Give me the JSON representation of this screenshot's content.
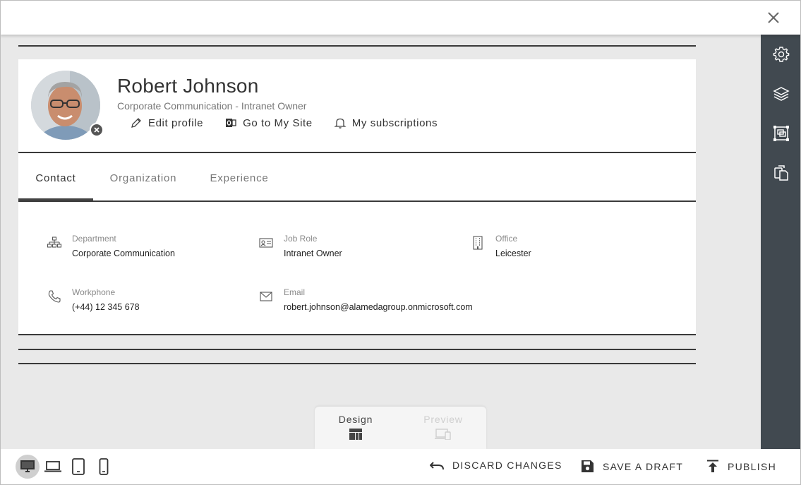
{
  "profile": {
    "name": "Robert Johnson",
    "subtitle": "Corporate Communication - Intranet Owner",
    "actions": [
      {
        "label": "Edit profile",
        "icon": "pencil-icon"
      },
      {
        "label": "Go to My Site",
        "icon": "outlook-icon"
      },
      {
        "label": "My subscriptions",
        "icon": "bell-icon"
      }
    ]
  },
  "tabs": [
    {
      "label": "Contact",
      "active": true
    },
    {
      "label": "Organization",
      "active": false
    },
    {
      "label": "Experience",
      "active": false
    }
  ],
  "fields": [
    {
      "label": "Department",
      "value": "Corporate Communication",
      "icon": "org-chart-icon"
    },
    {
      "label": "Job Role",
      "value": "Intranet Owner",
      "icon": "id-card-icon"
    },
    {
      "label": "Office",
      "value": "Leicester",
      "icon": "building-icon"
    },
    {
      "label": "Workphone",
      "value": "(+44) 12 345 678",
      "icon": "phone-icon"
    },
    {
      "label": "Email",
      "value": "robert.johnson@alamedagroup.onmicrosoft.com",
      "icon": "mail-icon"
    }
  ],
  "sidebar": {
    "items": [
      {
        "icon": "settings-icon"
      },
      {
        "icon": "layers-icon"
      },
      {
        "icon": "select-frame-icon"
      },
      {
        "icon": "copy-icon"
      }
    ]
  },
  "mode_toggle": {
    "design_label": "Design",
    "preview_label": "Preview",
    "active": "Design"
  },
  "bottombar": {
    "devices": [
      "desktop",
      "laptop",
      "tablet",
      "phone"
    ],
    "active_device": "desktop",
    "discard_label": "DISCARD CHANGES",
    "save_label": "SAVE A DRAFT",
    "publish_label": "PUBLISH"
  },
  "colors": {
    "sidebar_bg": "#414950",
    "canvas_bg": "#e9e9e9",
    "text_primary": "#333333",
    "text_muted": "#777777"
  }
}
